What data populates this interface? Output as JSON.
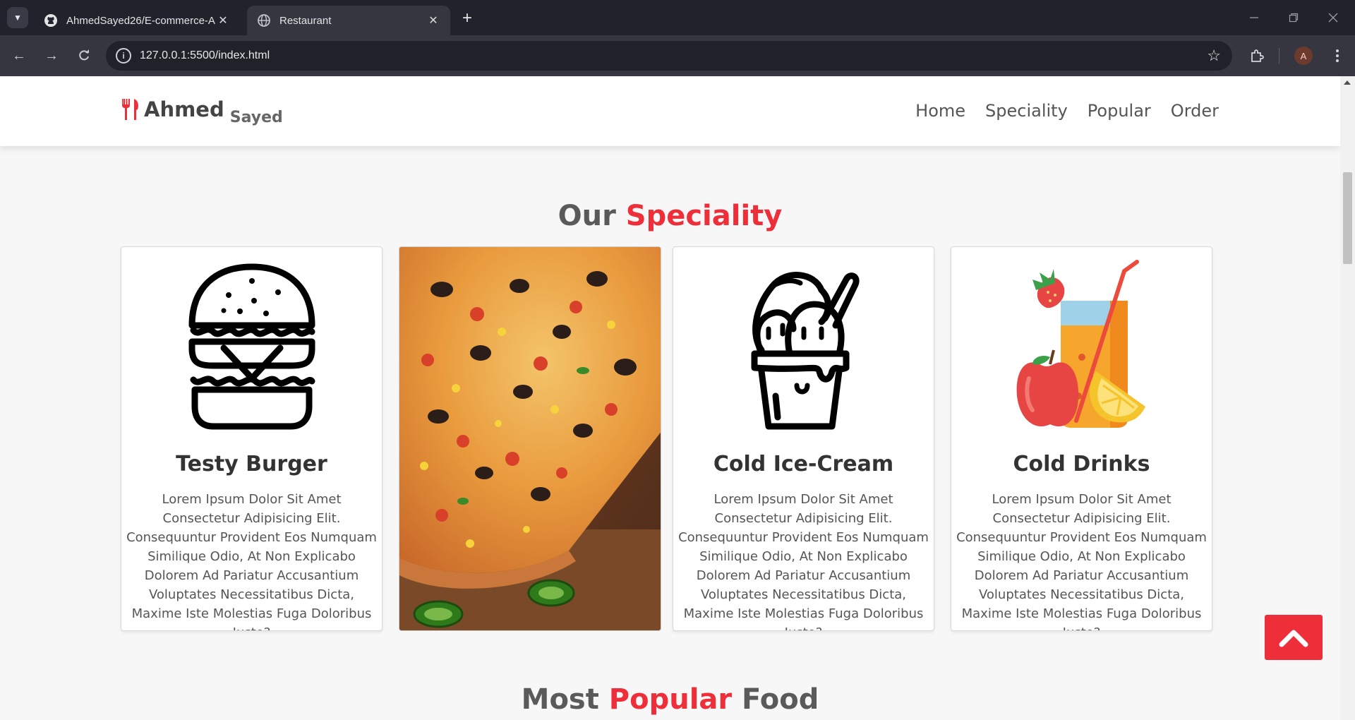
{
  "browser": {
    "tabs": [
      {
        "title": "AhmedSayed26/E-commerce-A",
        "favicon": "github-icon",
        "active": false
      },
      {
        "title": "Restaurant",
        "favicon": "globe-icon",
        "active": true
      }
    ],
    "url": "127.0.0.1:5500/index.html",
    "profile_initial": "A"
  },
  "site": {
    "logo": {
      "first": "Ahmed",
      "last": "Sayed",
      "icon": "utensils-icon",
      "icon_color": "#ee2f3a"
    },
    "nav": [
      "Home",
      "Speciality",
      "Popular",
      "Order"
    ],
    "speciality": {
      "title_plain": "Our ",
      "title_accent": "Speciality",
      "cards": [
        {
          "name": "Testy Burger",
          "icon": "burger-icon",
          "text": "Lorem Ipsum Dolor Sit Amet Consectetur Adipisicing Elit. Consequuntur Provident Eos Numquam Similique Odio, At Non Explicabo Dolorem Ad Pariatur Accusantium Voluptates Necessitatibus Dicta, Maxime Iste Molestias Fuga Doloribus Iusto?"
        },
        {
          "name": "",
          "icon": "pizza-photo",
          "text": ""
        },
        {
          "name": "Cold Ice-Cream",
          "icon": "ice-cream-icon",
          "text": "Lorem Ipsum Dolor Sit Amet Consectetur Adipisicing Elit. Consequuntur Provident Eos Numquam Similique Odio, At Non Explicabo Dolorem Ad Pariatur Accusantium Voluptates Necessitatibus Dicta, Maxime Iste Molestias Fuga Doloribus Iusto?"
        },
        {
          "name": "Cold Drinks",
          "icon": "drink-icon",
          "text": "Lorem Ipsum Dolor Sit Amet Consectetur Adipisicing Elit. Consequuntur Provident Eos Numquam Similique Odio, At Non Explicabo Dolorem Ad Pariatur Accusantium Voluptates Necessitatibus Dicta, Maxime Iste Molestias Fuga Doloribus Iusto?"
        }
      ]
    },
    "popular": {
      "title_before": "Most ",
      "title_accent": "Popular",
      "title_after": " Food"
    },
    "accent_color": "#ee2f3a"
  }
}
